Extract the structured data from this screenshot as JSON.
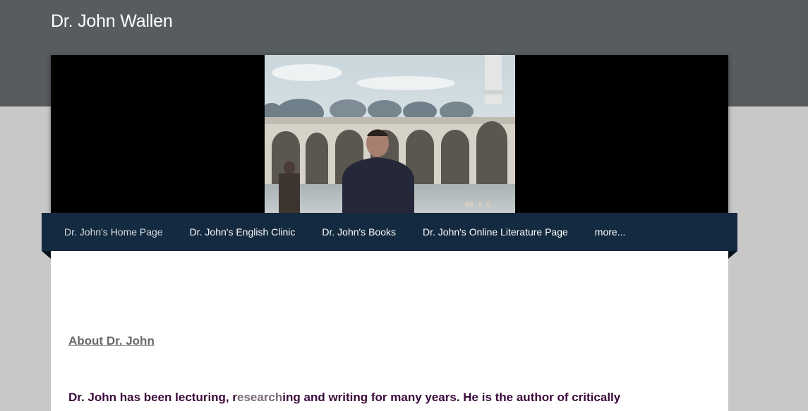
{
  "site": {
    "title": "Dr. John Wallen"
  },
  "nav": {
    "items": [
      {
        "label": "Dr. John's Home Page",
        "active": true
      },
      {
        "label": "Dr. John's English Clinic",
        "active": false
      },
      {
        "label": "Dr. John's Books",
        "active": false
      },
      {
        "label": "Dr. John's Online Literature Page",
        "active": false
      },
      {
        "label": "more...",
        "active": false
      }
    ]
  },
  "main": {
    "about_heading": "About Dr. John",
    "bio": {
      "part1": "Dr. John has been lecturing, r",
      "part2": "esearch",
      "part3": "ing and writing for many years. He is the author of critically"
    },
    "photo_timestamp": "'98 3 5"
  },
  "colors": {
    "header_bg": "#575c60",
    "nav_bg": "#142a40",
    "page_bg": "#c8c8c8",
    "bio_text": "#3a0a3a"
  }
}
